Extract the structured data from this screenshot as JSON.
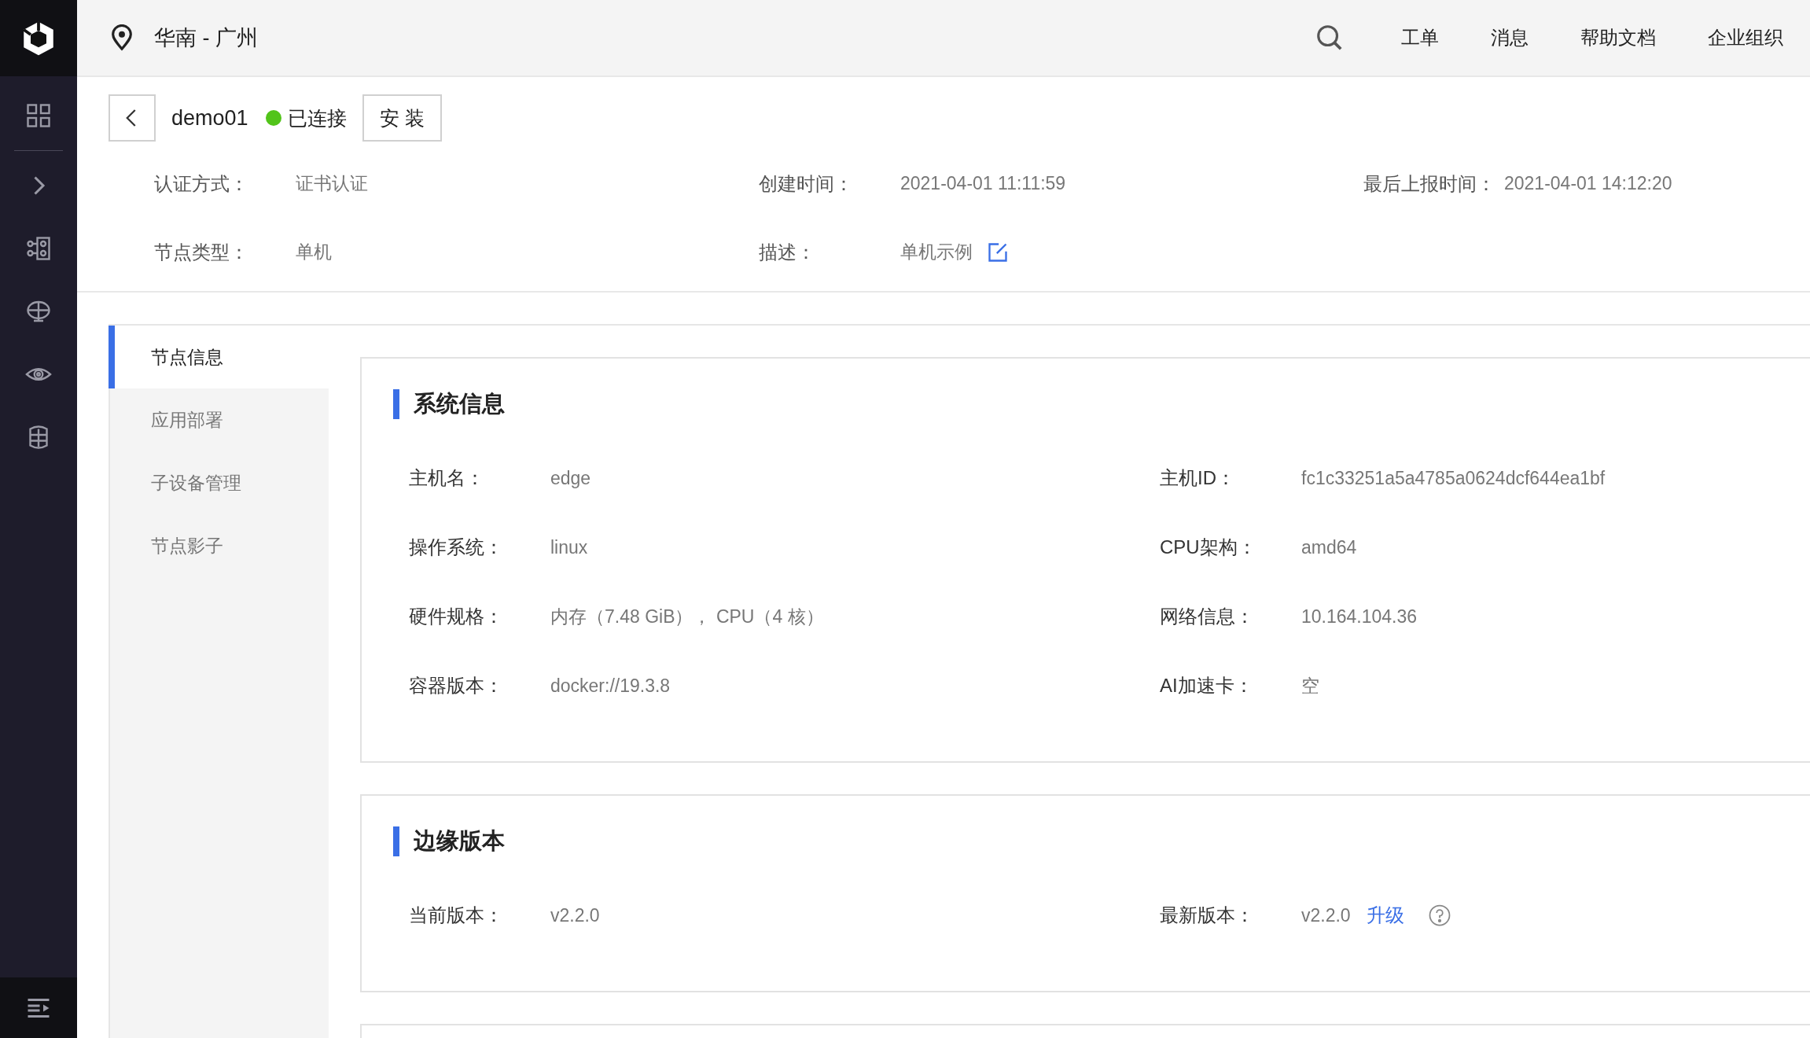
{
  "header": {
    "region": "华南 - 广州",
    "nav": [
      "工单",
      "消息",
      "帮助文档",
      "企业组织"
    ]
  },
  "node": {
    "name": "demo01",
    "status": {
      "text": "已连接",
      "color": "#52c41a"
    },
    "install_button": "安 装",
    "fields": [
      {
        "label": "认证方式：",
        "value": "证书认证"
      },
      {
        "label": "创建时间：",
        "value": "2021-04-01 11:11:59"
      },
      {
        "label": "最后上报时间：",
        "value": "2021-04-01 14:12:20"
      },
      {
        "label": "节点类型：",
        "value": "单机"
      },
      {
        "label": "描述：",
        "value": "单机示例",
        "editable": true
      }
    ]
  },
  "tabs": [
    {
      "label": "节点信息",
      "selected": true
    },
    {
      "label": "应用部署",
      "selected": false
    },
    {
      "label": "子设备管理",
      "selected": false
    },
    {
      "label": "节点影子",
      "selected": false
    }
  ],
  "sections": [
    {
      "title": "系统信息",
      "fields": [
        {
          "label": "主机名：",
          "value": "edge"
        },
        {
          "label": "主机ID：",
          "value": "fc1c33251a5a4785a0624dcf644ea1bf"
        },
        {
          "label": "操作系统：",
          "value": "linux"
        },
        {
          "label": "CPU架构：",
          "value": "amd64"
        },
        {
          "label": "硬件规格：",
          "value": "内存（7.48 GiB）， CPU（4 核）"
        },
        {
          "label": "网络信息：",
          "value": "10.164.104.36"
        },
        {
          "label": "容器版本：",
          "value": "docker://19.3.8"
        },
        {
          "label": "AI加速卡：",
          "value": "空"
        }
      ]
    },
    {
      "title": "边缘版本",
      "fields": [
        {
          "label": "当前版本：",
          "value": "v2.2.0"
        },
        {
          "label": "最新版本：",
          "value": "v2.2.0",
          "action": "升级",
          "help": true
        }
      ]
    }
  ]
}
